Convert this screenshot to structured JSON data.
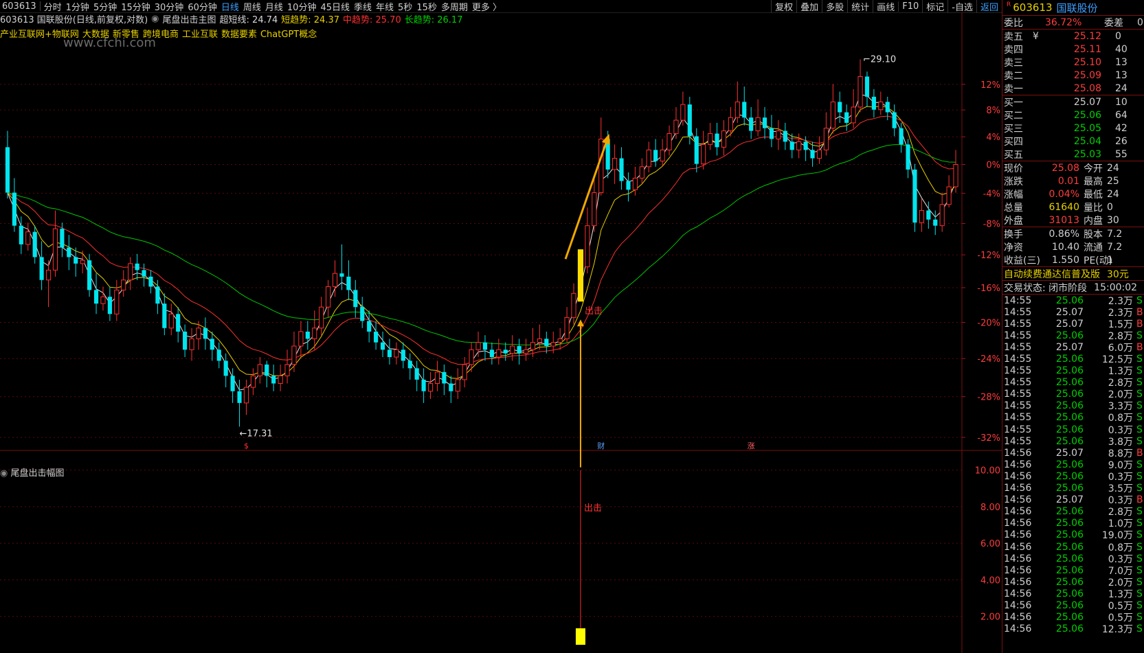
{
  "toolbar": {
    "code": "603613",
    "periods": [
      "分时",
      "1分钟",
      "5分钟",
      "15分钟",
      "30分钟",
      "60分钟",
      "日线",
      "周线",
      "月线",
      "10分钟",
      "45日线",
      "季线",
      "年线",
      "5秒",
      "15秒",
      "多周期",
      "更多 〉"
    ],
    "active_period": "日线",
    "right_items": [
      "复权",
      "叠加",
      "多股",
      "统计",
      "画线",
      "F10",
      "标记",
      "-自选",
      "返回"
    ]
  },
  "legend": {
    "title": "603613 国联股份(日线,前复权,对数)",
    "indicator": "尾盘出击主图",
    "super_short": "超短线: 24.74",
    "short": "短趋势: 24.37",
    "mid": "中趋势: 25.70",
    "long": "长趋势: 26.17",
    "colors": {
      "super_short": "#d8d8d8",
      "short": "#e8d000",
      "mid": "#ff3030",
      "long": "#00d000"
    }
  },
  "concepts": [
    "产业互联网+物联网",
    "大数据",
    "新零售",
    "跨境电商",
    "工业互联",
    "数据要素",
    "ChatGPT概念"
  ],
  "watermark": "www.cfchi.com",
  "subchart_title": "尾盘出击幅图",
  "chart_data": [
    {
      "type": "candlestick",
      "title": "603613 国联股份(日线,前复权,对数)",
      "y_scale": "log",
      "ylim": [
        17.0,
        30.5
      ],
      "y_tick_labels": [
        "12%",
        "8%",
        "4%",
        "0%",
        "-4%",
        "-8%",
        "-12%",
        "-16%",
        "-20%",
        "-24%",
        "-28%",
        "-32%"
      ],
      "y_tick_values": [
        28.09,
        27.09,
        26.08,
        25.08,
        24.08,
        23.07,
        22.07,
        21.07,
        20.06,
        19.06,
        18.06,
        17.05
      ],
      "annotations": [
        {
          "text": "29.10",
          "value": 29.1,
          "kind": "high"
        },
        {
          "text": "←17.31",
          "value": 17.31,
          "kind": "low"
        },
        {
          "text": "出击",
          "kind": "signal"
        }
      ],
      "event_markers": [
        "$",
        "财",
        "涨"
      ],
      "candles": [
        [
          25.7,
          24.1,
          26.3,
          23.9
        ],
        [
          24.1,
          23.0,
          24.6,
          22.8
        ],
        [
          23.0,
          22.4,
          23.3,
          22.1
        ],
        [
          22.4,
          22.8,
          23.1,
          22.2
        ],
        [
          22.8,
          22.0,
          23.0,
          21.8
        ],
        [
          22.0,
          21.3,
          22.5,
          21.0
        ],
        [
          21.3,
          21.6,
          21.9,
          20.5
        ],
        [
          21.6,
          22.9,
          23.5,
          21.4
        ],
        [
          22.9,
          22.3,
          23.1,
          22.0
        ],
        [
          22.3,
          22.0,
          22.7,
          21.6
        ],
        [
          22.0,
          21.8,
          22.3,
          21.4
        ],
        [
          21.8,
          21.9,
          22.2,
          21.5
        ],
        [
          21.9,
          21.0,
          22.1,
          20.8
        ],
        [
          21.0,
          20.6,
          21.5,
          20.3
        ],
        [
          20.6,
          20.8,
          21.1,
          20.4
        ],
        [
          20.8,
          20.3,
          21.1,
          20.1
        ],
        [
          20.3,
          21.0,
          21.3,
          20.1
        ],
        [
          21.0,
          21.3,
          21.6,
          20.8
        ],
        [
          21.3,
          21.8,
          22.0,
          21.0
        ],
        [
          21.8,
          21.6,
          22.1,
          21.3
        ],
        [
          21.6,
          21.4,
          21.8,
          21.1
        ],
        [
          21.4,
          21.1,
          21.6,
          20.9
        ],
        [
          21.1,
          20.6,
          21.3,
          20.3
        ],
        [
          20.6,
          19.9,
          20.9,
          19.7
        ],
        [
          19.9,
          20.3,
          20.6,
          19.7
        ],
        [
          20.3,
          19.8,
          20.5,
          19.5
        ],
        [
          19.8,
          19.3,
          20.0,
          19.1
        ],
        [
          19.3,
          19.6,
          19.9,
          19.0
        ],
        [
          19.6,
          19.9,
          20.1,
          19.3
        ],
        [
          19.9,
          19.6,
          20.2,
          19.3
        ],
        [
          19.6,
          19.3,
          19.8,
          19.0
        ],
        [
          19.3,
          19.0,
          19.5,
          18.8
        ],
        [
          19.0,
          18.6,
          19.2,
          18.3
        ],
        [
          18.6,
          18.2,
          18.8,
          17.9
        ],
        [
          18.2,
          17.9,
          18.5,
          17.31
        ],
        [
          17.9,
          18.3,
          18.5,
          17.6
        ],
        [
          18.3,
          18.6,
          18.8,
          18.1
        ],
        [
          18.6,
          18.9,
          19.1,
          18.4
        ],
        [
          18.9,
          18.6,
          19.0,
          18.3
        ],
        [
          18.6,
          18.4,
          18.9,
          18.2
        ],
        [
          18.4,
          18.6,
          18.9,
          18.2
        ],
        [
          18.6,
          18.9,
          19.3,
          18.4
        ],
        [
          18.9,
          19.4,
          19.8,
          18.7
        ],
        [
          19.4,
          19.8,
          20.1,
          19.1
        ],
        [
          19.8,
          19.6,
          20.1,
          19.3
        ],
        [
          19.6,
          19.9,
          20.4,
          19.3
        ],
        [
          19.9,
          20.5,
          20.8,
          19.7
        ],
        [
          20.5,
          21.1,
          21.3,
          20.2
        ],
        [
          21.1,
          21.5,
          21.9,
          20.8
        ],
        [
          21.5,
          21.4,
          22.4,
          21.0
        ],
        [
          21.4,
          21.0,
          21.9,
          20.7
        ],
        [
          21.0,
          20.5,
          21.3,
          20.2
        ],
        [
          20.5,
          20.1,
          20.8,
          19.9
        ],
        [
          20.1,
          19.8,
          20.4,
          19.5
        ],
        [
          19.8,
          19.5,
          20.1,
          19.3
        ],
        [
          19.5,
          19.3,
          19.8,
          19.1
        ],
        [
          19.3,
          19.1,
          19.6,
          18.9
        ],
        [
          19.1,
          19.3,
          19.5,
          18.9
        ],
        [
          19.3,
          19.0,
          19.5,
          18.8
        ],
        [
          19.0,
          18.8,
          19.2,
          18.5
        ],
        [
          18.8,
          18.5,
          19.0,
          18.2
        ],
        [
          18.5,
          18.2,
          18.8,
          17.9
        ],
        [
          18.2,
          18.4,
          18.7,
          18.0
        ],
        [
          18.4,
          18.7,
          19.0,
          18.2
        ],
        [
          18.7,
          18.4,
          18.9,
          18.1
        ],
        [
          18.4,
          18.2,
          18.6,
          17.9
        ],
        [
          18.2,
          18.5,
          18.8,
          18.0
        ],
        [
          18.5,
          18.9,
          19.1,
          18.3
        ],
        [
          18.9,
          19.3,
          19.5,
          18.7
        ],
        [
          19.3,
          19.5,
          19.8,
          19.1
        ],
        [
          19.5,
          19.3,
          19.7,
          19.0
        ],
        [
          19.3,
          19.1,
          19.5,
          18.9
        ],
        [
          19.1,
          19.3,
          19.6,
          18.9
        ],
        [
          19.3,
          19.2,
          19.5,
          19.0
        ],
        [
          19.2,
          19.4,
          19.7,
          19.0
        ],
        [
          19.4,
          19.2,
          19.6,
          18.9
        ],
        [
          19.2,
          19.3,
          19.6,
          19.0
        ],
        [
          19.3,
          19.5,
          19.9,
          19.1
        ],
        [
          19.5,
          19.6,
          20.0,
          19.3
        ],
        [
          19.6,
          19.4,
          19.8,
          19.2
        ],
        [
          19.4,
          19.5,
          19.8,
          19.2
        ],
        [
          19.5,
          19.6,
          19.9,
          19.3
        ],
        [
          19.6,
          20.2,
          20.5,
          19.5
        ],
        [
          20.2,
          20.9,
          21.2,
          20.0
        ],
        [
          20.9,
          21.7,
          22.2,
          20.7
        ],
        [
          21.7,
          23.0,
          23.6,
          21.5
        ],
        [
          23.0,
          24.1,
          24.6,
          22.8
        ],
        [
          24.1,
          26.0,
          26.8,
          24.0
        ],
        [
          26.0,
          24.9,
          26.3,
          24.6
        ],
        [
          24.9,
          25.3,
          25.8,
          24.4
        ],
        [
          25.3,
          24.5,
          25.7,
          24.2
        ],
        [
          24.5,
          24.2,
          24.8,
          23.8
        ],
        [
          24.2,
          24.6,
          25.0,
          24.0
        ],
        [
          24.6,
          25.0,
          25.3,
          24.4
        ],
        [
          25.0,
          25.6,
          25.9,
          24.8
        ],
        [
          25.6,
          25.2,
          26.0,
          25.0
        ],
        [
          25.2,
          25.6,
          26.0,
          25.0
        ],
        [
          25.6,
          26.2,
          26.5,
          25.4
        ],
        [
          26.2,
          26.7,
          27.2,
          26.0
        ],
        [
          26.7,
          27.3,
          27.8,
          26.5
        ],
        [
          27.3,
          26.1,
          27.6,
          25.8
        ],
        [
          26.1,
          25.1,
          26.4,
          24.8
        ],
        [
          25.1,
          25.8,
          26.3,
          24.9
        ],
        [
          25.8,
          26.2,
          26.6,
          25.6
        ],
        [
          26.2,
          25.7,
          26.6,
          25.4
        ],
        [
          25.7,
          26.3,
          26.7,
          25.4
        ],
        [
          26.3,
          26.8,
          27.2,
          26.1
        ],
        [
          26.8,
          27.4,
          28.2,
          26.6
        ],
        [
          27.4,
          26.8,
          28.0,
          26.5
        ],
        [
          26.8,
          26.3,
          27.2,
          26.0
        ],
        [
          26.3,
          26.8,
          27.5,
          26.1
        ],
        [
          26.8,
          26.4,
          27.2,
          26.0
        ],
        [
          26.4,
          26.0,
          26.9,
          25.7
        ],
        [
          26.0,
          26.3,
          26.7,
          25.6
        ],
        [
          26.3,
          25.9,
          26.6,
          25.6
        ],
        [
          25.9,
          25.6,
          26.2,
          25.3
        ],
        [
          25.6,
          25.9,
          26.2,
          25.3
        ],
        [
          25.9,
          25.6,
          26.1,
          25.2
        ],
        [
          25.6,
          25.3,
          25.9,
          25.0
        ],
        [
          25.3,
          25.6,
          26.1,
          25.1
        ],
        [
          25.6,
          26.4,
          27.0,
          25.4
        ],
        [
          26.4,
          27.4,
          28.1,
          26.2
        ],
        [
          27.4,
          27.0,
          27.8,
          26.6
        ],
        [
          27.0,
          26.6,
          27.3,
          26.3
        ],
        [
          26.6,
          27.2,
          27.9,
          26.4
        ],
        [
          27.2,
          28.4,
          29.1,
          27.0
        ],
        [
          28.4,
          27.6,
          28.6,
          27.2
        ],
        [
          27.6,
          27.1,
          27.9,
          26.8
        ],
        [
          27.1,
          27.4,
          27.8,
          26.9
        ],
        [
          27.4,
          27.0,
          27.6,
          26.7
        ],
        [
          27.0,
          26.4,
          27.3,
          26.1
        ],
        [
          26.4,
          25.8,
          26.6,
          25.5
        ],
        [
          25.8,
          24.9,
          26.0,
          24.6
        ],
        [
          24.9,
          23.1,
          25.1,
          22.8
        ],
        [
          23.1,
          23.5,
          23.9,
          22.8
        ],
        [
          23.5,
          23.2,
          23.8,
          22.9
        ],
        [
          23.2,
          23.0,
          23.5,
          22.7
        ],
        [
          23.0,
          23.7,
          24.1,
          22.8
        ],
        [
          23.7,
          24.3,
          24.7,
          23.6
        ],
        [
          24.3,
          25.08,
          25.6,
          24.1
        ]
      ],
      "lines": [
        {
          "name": "超短线",
          "last": 24.74
        },
        {
          "name": "短趋势",
          "last": 24.37
        },
        {
          "name": "中趋势",
          "last": 25.7
        },
        {
          "name": "长趋势",
          "last": 26.17
        }
      ]
    },
    {
      "type": "bar",
      "title": "尾盘出击幅图",
      "ylim": [
        0,
        11
      ],
      "y_tick_labels": [
        "10.00",
        "8.00",
        "6.00",
        "4.00",
        "2.00"
      ],
      "y_tick_values": [
        10,
        8,
        6,
        4,
        2
      ],
      "signal_index": 84,
      "signal_label": "出击",
      "signal_height": 10.0,
      "signal_bar": 0.9
    }
  ],
  "panel": {
    "code": "603613",
    "name": "国联股份",
    "weibi_label": "委比",
    "weibi_value": "36.72%",
    "weicha_label": "委差",
    "weicha_value": "0",
    "asks": [
      {
        "label": "卖五",
        "sym": "¥",
        "price": "25.12",
        "vol": "0"
      },
      {
        "label": "卖四",
        "sym": "",
        "price": "25.11",
        "vol": "40"
      },
      {
        "label": "卖三",
        "sym": "",
        "price": "25.10",
        "vol": "13"
      },
      {
        "label": "卖二",
        "sym": "",
        "price": "25.09",
        "vol": "13"
      },
      {
        "label": "卖一",
        "sym": "",
        "price": "25.08",
        "vol": "24"
      }
    ],
    "bids": [
      {
        "label": "买一",
        "price": "25.07",
        "vol": "10",
        "color": "#d0d0d0"
      },
      {
        "label": "买二",
        "price": "25.06",
        "vol": "64",
        "color": "#00d000"
      },
      {
        "label": "买三",
        "price": "25.05",
        "vol": "42",
        "color": "#00d000"
      },
      {
        "label": "买四",
        "price": "25.04",
        "vol": "26",
        "color": "#00d000"
      },
      {
        "label": "买五",
        "price": "25.03",
        "vol": "55",
        "color": "#00d000"
      }
    ],
    "stats": [
      {
        "l1": "现价",
        "v1": "25.08",
        "c1": "#ff3c3c",
        "l2": "今开",
        "v2": "24"
      },
      {
        "l1": "涨跌",
        "v1": "0.01",
        "c1": "#ff3c3c",
        "l2": "最高",
        "v2": "25"
      },
      {
        "l1": "涨幅",
        "v1": "0.04%",
        "c1": "#ff3c3c",
        "l2": "最低",
        "v2": "24"
      },
      {
        "l1": "总量",
        "v1": "61640",
        "c1": "#e8d000",
        "l2": "量比",
        "v2": "0"
      },
      {
        "l1": "外盘",
        "v1": "31013",
        "c1": "#ff3c3c",
        "l2": "内盘",
        "v2": "30"
      }
    ],
    "stats2": [
      {
        "l1": "换手",
        "v1": "0.86%",
        "c1": "#d0d0d0",
        "l2": "股本",
        "v2": "7.2"
      },
      {
        "l1": "净资",
        "v1": "10.40",
        "c1": "#d0d0d0",
        "l2": "流通",
        "v2": "7.2"
      },
      {
        "l1": "收益(三)",
        "v1": "1.550",
        "c1": "#d0d0d0",
        "l2": "PE(动)",
        "v2": "1"
      }
    ],
    "promo": "自动续费通达信普及版",
    "promo_price": "30元",
    "trade_state_label": "交易状态: 闭市阶段",
    "trade_state_time": "15:00:02",
    "ticks": [
      [
        "14:55",
        "25.06",
        "2.3万",
        "S"
      ],
      [
        "14:55",
        "25.07",
        "2.3万",
        "B"
      ],
      [
        "14:55",
        "25.07",
        "1.5万",
        "B"
      ],
      [
        "14:55",
        "25.06",
        "2.8万",
        "S"
      ],
      [
        "14:55",
        "25.07",
        "6.0万",
        "B"
      ],
      [
        "14:55",
        "25.06",
        "12.5万",
        "S"
      ],
      [
        "14:55",
        "25.06",
        "1.3万",
        "S"
      ],
      [
        "14:55",
        "25.06",
        "2.8万",
        "S"
      ],
      [
        "14:55",
        "25.06",
        "2.0万",
        "S"
      ],
      [
        "14:55",
        "25.06",
        "3.3万",
        "S"
      ],
      [
        "14:55",
        "25.06",
        "0.8万",
        "S"
      ],
      [
        "14:55",
        "25.06",
        "0.3万",
        "S"
      ],
      [
        "14:55",
        "25.06",
        "3.8万",
        "S"
      ],
      [
        "14:56",
        "25.07",
        "8.8万",
        "B"
      ],
      [
        "14:56",
        "25.06",
        "9.0万",
        "S"
      ],
      [
        "14:56",
        "25.06",
        "0.3万",
        "S"
      ],
      [
        "14:56",
        "25.06",
        "3.5万",
        "S"
      ],
      [
        "14:56",
        "25.07",
        "0.3万",
        "B"
      ],
      [
        "14:56",
        "25.06",
        "2.8万",
        "S"
      ],
      [
        "14:56",
        "25.06",
        "1.0万",
        "S"
      ],
      [
        "14:56",
        "25.06",
        "19.0万",
        "S"
      ],
      [
        "14:56",
        "25.06",
        "0.8万",
        "S"
      ],
      [
        "14:56",
        "25.06",
        "0.3万",
        "S"
      ],
      [
        "14:56",
        "25.06",
        "7.0万",
        "S"
      ],
      [
        "14:56",
        "25.06",
        "2.0万",
        "S"
      ],
      [
        "14:56",
        "25.06",
        "1.3万",
        "S"
      ],
      [
        "14:56",
        "25.06",
        "0.5万",
        "S"
      ],
      [
        "14:56",
        "25.06",
        "0.5万",
        "S"
      ],
      [
        "14:56",
        "25.06",
        "12.3万",
        "S"
      ]
    ]
  }
}
